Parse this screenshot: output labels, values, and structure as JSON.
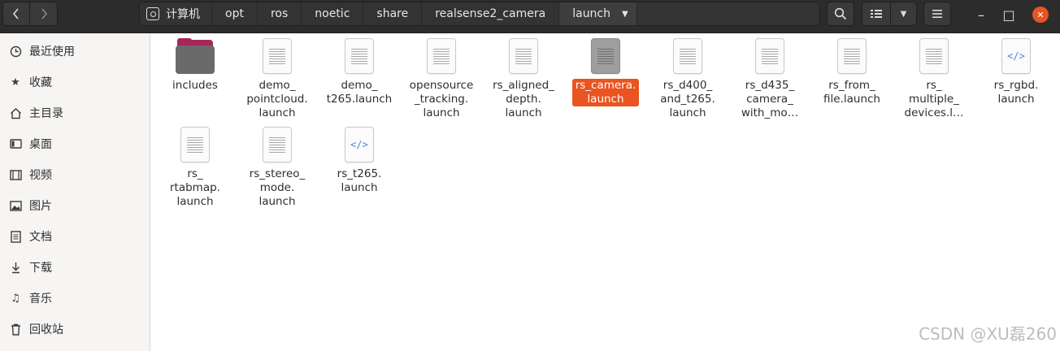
{
  "nav": {
    "back_icon": "chevron-left-icon",
    "forward_icon": "chevron-right-icon"
  },
  "path": {
    "root_icon": "disk-icon",
    "segments": [
      "计算机",
      "opt",
      "ros",
      "noetic",
      "share",
      "realsense2_camera",
      "launch"
    ]
  },
  "toolbar": {
    "search_icon": "search-icon",
    "view_icon": "list-view-icon",
    "menu_icon": "hamburger-menu-icon"
  },
  "window": {
    "minimize": "–",
    "maximize": "□",
    "close": "✕",
    "accent": "#e95420"
  },
  "sidebar": {
    "items": [
      {
        "label": "最近使用",
        "icon": "clock-icon"
      },
      {
        "label": "收藏",
        "icon": "star-icon"
      },
      {
        "label": "主目录",
        "icon": "home-icon"
      },
      {
        "label": "桌面",
        "icon": "desktop-icon"
      },
      {
        "label": "视频",
        "icon": "film-icon"
      },
      {
        "label": "图片",
        "icon": "image-icon"
      },
      {
        "label": "文档",
        "icon": "document-icon"
      },
      {
        "label": "下载",
        "icon": "download-icon"
      },
      {
        "label": "音乐",
        "icon": "music-icon"
      },
      {
        "label": "回收站",
        "icon": "trash-icon"
      }
    ]
  },
  "files": [
    {
      "name": "includes",
      "type": "folder"
    },
    {
      "name": "demo_\npointcloud.\nlaunch",
      "type": "text"
    },
    {
      "name": "demo_\nt265.launch",
      "type": "text"
    },
    {
      "name": "opensource\n_tracking.\nlaunch",
      "type": "text"
    },
    {
      "name": "rs_aligned_\ndepth.\nlaunch",
      "type": "text"
    },
    {
      "name": "rs_camera.\nlaunch",
      "type": "text",
      "selected": true
    },
    {
      "name": "rs_d400_\nand_t265.\nlaunch",
      "type": "text"
    },
    {
      "name": "rs_d435_\ncamera_\nwith_mo…",
      "type": "text"
    },
    {
      "name": "rs_from_\nfile.launch",
      "type": "text"
    },
    {
      "name": "rs_\nmultiple_\ndevices.l…",
      "type": "text"
    },
    {
      "name": "rs_rgbd.\nlaunch",
      "type": "code"
    },
    {
      "name": "rs_\nrtabmap.\nlaunch",
      "type": "text"
    },
    {
      "name": "rs_stereo_\nmode.\nlaunch",
      "type": "text"
    },
    {
      "name": "rs_t265.\nlaunch",
      "type": "code"
    }
  ],
  "watermark": "CSDN @XU磊260"
}
